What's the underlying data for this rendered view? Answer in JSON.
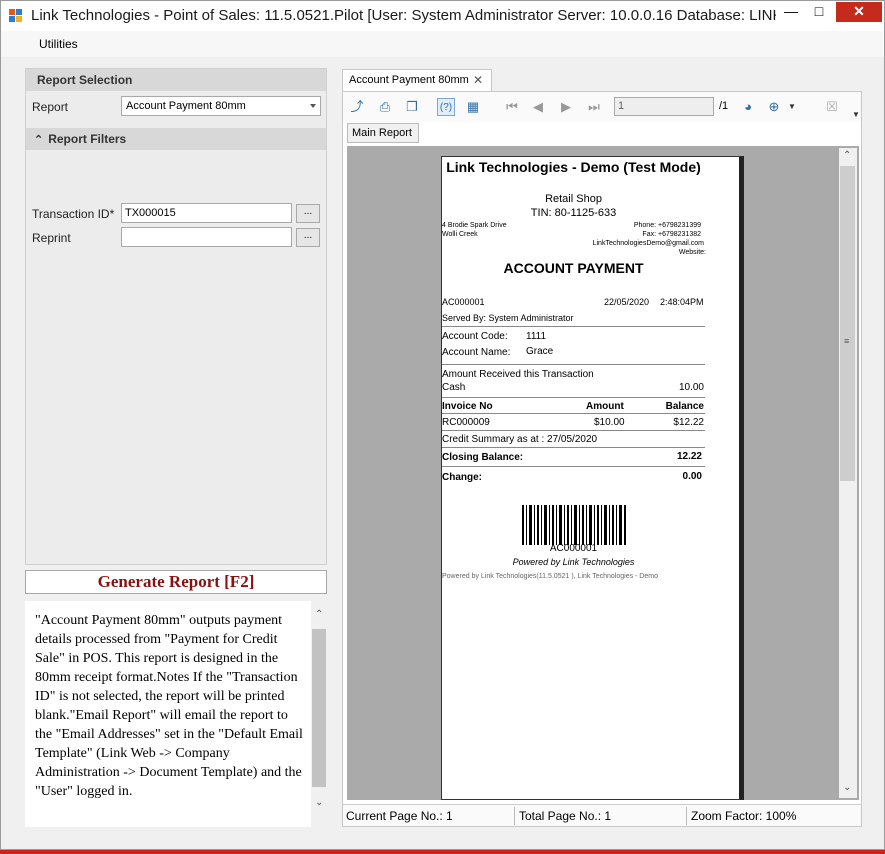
{
  "window": {
    "title": "Link Technologies - Point of Sales: 11.5.0521.Pilot [User: System Administrator Server: 10.0.0.16 Database: LINK...",
    "minimize_icon": "minimize-icon",
    "maximize_icon": "maximize-icon",
    "close_icon": "close-icon"
  },
  "menu": {
    "utilities": "Utilities"
  },
  "report_selection": {
    "header": "Report Selection",
    "report_label": "Report",
    "report_value": "Account Payment 80mm"
  },
  "report_filters": {
    "header": "Report Filters",
    "transaction_label": "Transaction ID*",
    "transaction_value": "TX000015",
    "reprint_label": "Reprint",
    "reprint_value": "",
    "browse_label": "..."
  },
  "generate_button": "Generate Report [F2]",
  "description": "\"Account Payment 80mm\" outputs payment details processed from \"Payment for Credit Sale\" in POS. This report is designed in the 80mm receipt format.Notes If the \"Transaction ID\" is not selected, the report will be printed blank.\"Email Report\" will email the report to the \"Email Addresses\" set in the \"Default Email Template\" (Link Web -> Company Administration -> Document Template) and the \"User\" logged in.",
  "viewer": {
    "tab_label": "Account Payment 80mm",
    "subtab_label": "Main Report",
    "page_value": "1",
    "page_total": "/1"
  },
  "receipt": {
    "company": "Link Technologies - Demo (Test Mode)",
    "shop": "Retail Shop",
    "tin": "TIN: 80-1125-633",
    "address1": "4 Brodie Spark Drive",
    "address2": "Wolli Creek",
    "phone": "Phone: +6798231399",
    "fax": "Fax: +6798231382",
    "email": "LinkTechnologiesDemo@gmail.com",
    "website": "Website:",
    "heading": "ACCOUNT PAYMENT",
    "doc_no": "AC000001",
    "date": "22/05/2020",
    "time": "2:48:04PM",
    "served_by": "Served By: System Administrator",
    "account_code_label": "Account Code:",
    "account_code": "1111",
    "account_name_label": "Account Name:",
    "account_name": "Grace",
    "amount_received_label": "Amount Received this Transaction",
    "cash_label": "Cash",
    "cash_value": "10.00",
    "col_invoice": "Invoice No",
    "col_amount": "Amount",
    "col_balance": "Balance",
    "row_invoice": "RC000009",
    "row_amount": "$10.00",
    "row_balance": "$12.22",
    "credit_summary": "Credit Summary as at : 27/05/2020",
    "closing_label": "Closing Balance:",
    "closing_value": "12.22",
    "change_label": "Change:",
    "change_value": "0.00",
    "barcode_text": "AC000001",
    "powered": "Powered by Link Technologies",
    "footer": "Powered by Link Technologies(11.5.0521 ), Link Technologies - Demo"
  },
  "status": {
    "current_page": "Current Page No.: 1",
    "total_page": "Total Page No.: 1",
    "zoom": "Zoom Factor: 100%"
  },
  "colors": {
    "accent": "#c42b1c",
    "generate_text": "#8b1010",
    "background_frame": "#cf1f1f"
  }
}
